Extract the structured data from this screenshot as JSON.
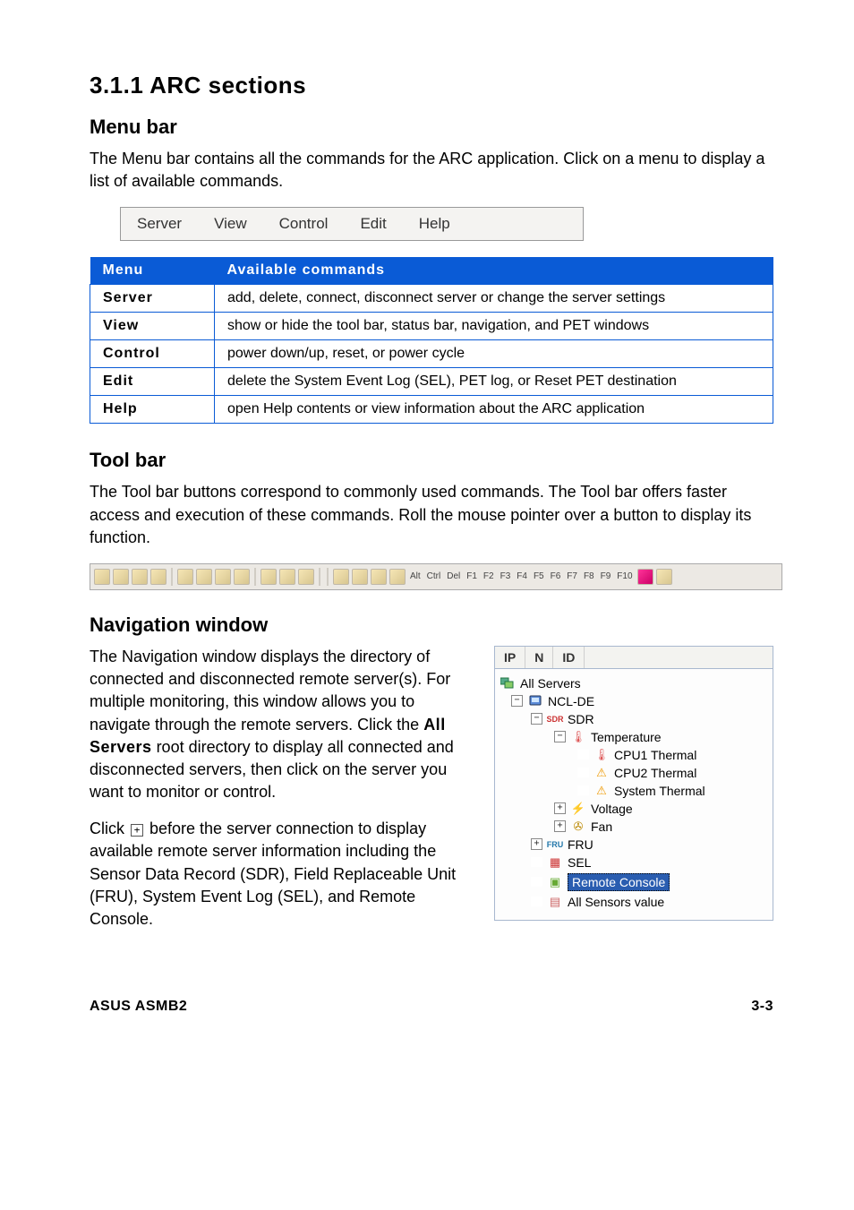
{
  "section": {
    "number_title": "3.1.1   ARC sections"
  },
  "menubar_section": {
    "heading": "Menu bar",
    "para": "The Menu bar contains all the commands for the ARC application. Click on a menu to display a list of available commands.",
    "items": [
      "Server",
      "View",
      "Control",
      "Edit",
      "Help"
    ]
  },
  "cmd_table": {
    "head_menu": "Menu",
    "head_cmds": "Available commands",
    "rows": [
      {
        "name": "Server",
        "desc": "add, delete, connect, disconnect server or change the server settings"
      },
      {
        "name": "View",
        "desc": "show or hide the tool bar, status bar, navigation, and PET windows"
      },
      {
        "name": "Control",
        "desc": "power down/up, reset, or power cycle"
      },
      {
        "name": "Edit",
        "desc": "delete the System Event Log (SEL), PET log, or Reset PET destination"
      },
      {
        "name": "Help",
        "desc": "open Help contents or view information about the ARC application"
      }
    ]
  },
  "toolbar_section": {
    "heading": "Tool bar",
    "para": "The Tool bar buttons correspond to commonly used commands. The Tool bar offers faster access and execution of these commands. Roll the mouse pointer over a button to display its function.",
    "keys": [
      "Alt",
      "Ctrl",
      "Del",
      "F1",
      "F2",
      "F3",
      "F4",
      "F5",
      "F6",
      "F7",
      "F8",
      "F9",
      "F10"
    ]
  },
  "nav_section": {
    "heading": "Navigation window",
    "para1_a": "The Navigation window displays the directory of connected and disconnected remote server(s). For multiple monitoring, this window allows you to navigate through the remote servers. Click the ",
    "para1_bold": "All Servers",
    "para1_b": " root directory to display all connected and disconnected servers, then click on the server you want to monitor or control.",
    "para2_a": "Click ",
    "para2_b": " before the server connection to display available remote server information including the Sensor Data Record (SDR), Field Replaceable Unit (FRU), System Event Log (SEL), and Remote Console."
  },
  "tree": {
    "tabs": [
      "IP",
      "N",
      "ID"
    ],
    "root": "All Servers",
    "server": "NCL-DE",
    "sdr": "SDR",
    "temperature": "Temperature",
    "cpu1": "CPU1 Thermal",
    "cpu2": "CPU2 Thermal",
    "system": "System Thermal",
    "voltage": "Voltage",
    "fan": "Fan",
    "fru": "FRU",
    "sel": "SEL",
    "remote": "Remote Console",
    "allsensors": "All Sensors value"
  },
  "footer": {
    "left": "ASUS ASMB2",
    "right": "3-3"
  },
  "glyphs": {
    "plus": "+",
    "minus": "−"
  }
}
